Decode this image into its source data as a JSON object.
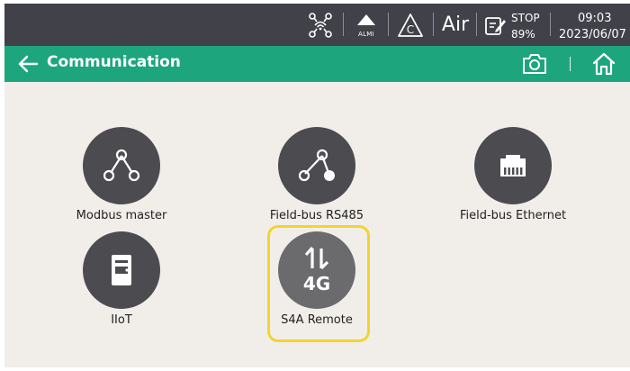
{
  "statusbar": {
    "network_icon": "network-wifi-icon",
    "alarm": {
      "icon": "alarm-triangle-icon",
      "label": "ALMI"
    },
    "warning_icon": "warning-c-icon",
    "air_label": "Air",
    "stop_icon": "note-edit-icon",
    "stop_text": "STOP",
    "percent": "89%",
    "time": "09:03",
    "date": "2023/06/07"
  },
  "titlebar": {
    "back_icon": "back-arrow-icon",
    "title": "Communication",
    "camera_icon": "camera-icon",
    "home_icon": "home-icon"
  },
  "tiles": [
    {
      "label": "Modbus master",
      "icon": "share-nodes-icon",
      "selected": false
    },
    {
      "label": "Field-bus RS485",
      "icon": "share-nodes-filled-icon",
      "selected": false
    },
    {
      "label": "Field-bus Ethernet",
      "icon": "ethernet-port-icon",
      "selected": false
    },
    {
      "label": "IIoT",
      "icon": "server-icon",
      "selected": false
    },
    {
      "label": "S4A Remote",
      "icon": "4g-transfer-icon",
      "badge": "4G",
      "selected": true
    }
  ],
  "colors": {
    "statusbar_bg": "#404149",
    "titlebar_bg": "#1da57e",
    "tile_circle": "#4b4b50",
    "selection_border": "#f3d42b",
    "background": "#f1eeea"
  }
}
